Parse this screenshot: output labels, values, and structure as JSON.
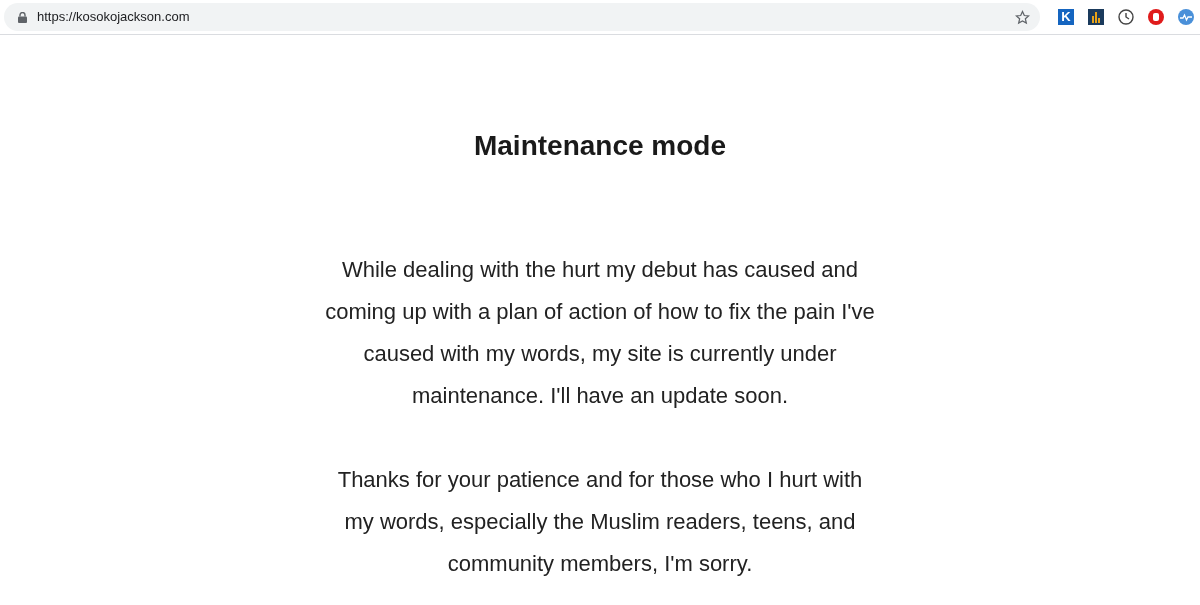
{
  "address_bar": {
    "url": "https://kosokojackson.com"
  },
  "extensions": [
    {
      "kind": "letter",
      "label": "K"
    },
    {
      "kind": "chart"
    },
    {
      "kind": "clock"
    },
    {
      "kind": "hand"
    },
    {
      "kind": "pulse"
    }
  ],
  "page": {
    "title": "Maintenance mode",
    "paragraphs": [
      "While dealing with the hurt my debut has caused and coming up with a plan of action of how to fix the pain I've caused with my words, my site is currently under maintenance. I'll have an update soon.",
      "Thanks for your patience and for those who I hurt with my words, especially the Muslim readers, teens, and community members, I'm sorry."
    ]
  }
}
